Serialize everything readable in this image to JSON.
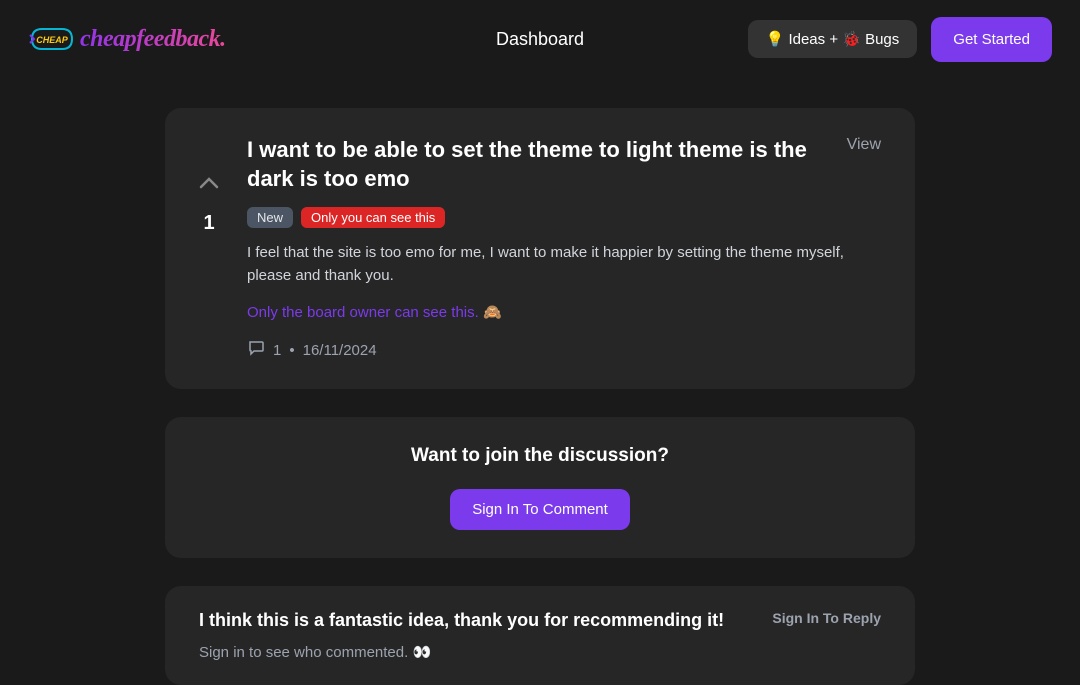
{
  "header": {
    "logo_text": "cheapfeedback.",
    "nav_dashboard": "Dashboard",
    "btn_ideas_bugs": "💡 Ideas + 🐞 Bugs",
    "btn_get_started": "Get Started"
  },
  "post": {
    "title": "I want to be able to set the theme to light theme is the dark is too emo",
    "view_label": "View",
    "badge_new": "New",
    "badge_private": "Only you can see this",
    "body": "I feel that the site is too emo for me, I want to make it happier by setting the theme myself, please and thank you.",
    "owner_note": "Only the board owner can see this. 🙈",
    "vote_count": "1",
    "comment_count": "1",
    "meta_separator": "•",
    "date": "16/11/2024"
  },
  "discussion": {
    "title": "Want to join the discussion?",
    "btn_signin_comment": "Sign In To Comment"
  },
  "reply": {
    "title": "I think this is a fantastic idea, thank you for recommending it!",
    "btn_signin_reply": "Sign In To Reply",
    "subtitle": "Sign in to see who commented. 👀"
  }
}
